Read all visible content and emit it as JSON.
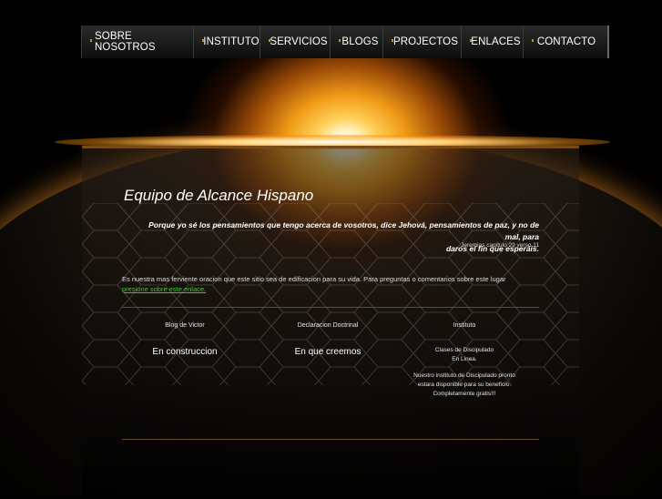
{
  "nav": {
    "items": [
      {
        "label": "SOBRE NOSOTROS"
      },
      {
        "label": "INSTITUTO"
      },
      {
        "label": "SERVICIOS"
      },
      {
        "label": "BLOGS"
      },
      {
        "label": "PROJECTOS"
      },
      {
        "label": "ENLACES"
      },
      {
        "label": "CONTACTO"
      }
    ]
  },
  "content": {
    "title": "Equipo de Alcance Hispano",
    "quote_line1": "Porque yo sé los pensamientos que tengo acerca de vosotros, dice Jehová, pensamientos de paz, y no de mal, para",
    "quote_line2": "daros el fin que esperáis.",
    "quote_ref": "Jeremias capitulo 29 verso 11",
    "intro_text": "Es nuestra mas ferviente oracion que este sitio sea de edificacion para su vida. Para preguntas o comentarios sobre este lugar",
    "intro_link": "presione sobre este enlace."
  },
  "columns": [
    {
      "heading": "Blog de Victor",
      "big": "En construccion"
    },
    {
      "heading": "Declaracion Doctrinal",
      "big": "En que creemos"
    },
    {
      "heading": "Instituto",
      "small1": "Clases de Discipulado",
      "small2": "En Linea.",
      "small3": "Nuestro instituto de Discipulado pronto",
      "small4": "estara disponible para su beneficio.",
      "small5": "Completamente gratis!!!"
    }
  ],
  "colors": {
    "accent_orange": "#d98a1a",
    "link_green": "#3ccc2a",
    "panel_border": "#7a4a16"
  }
}
